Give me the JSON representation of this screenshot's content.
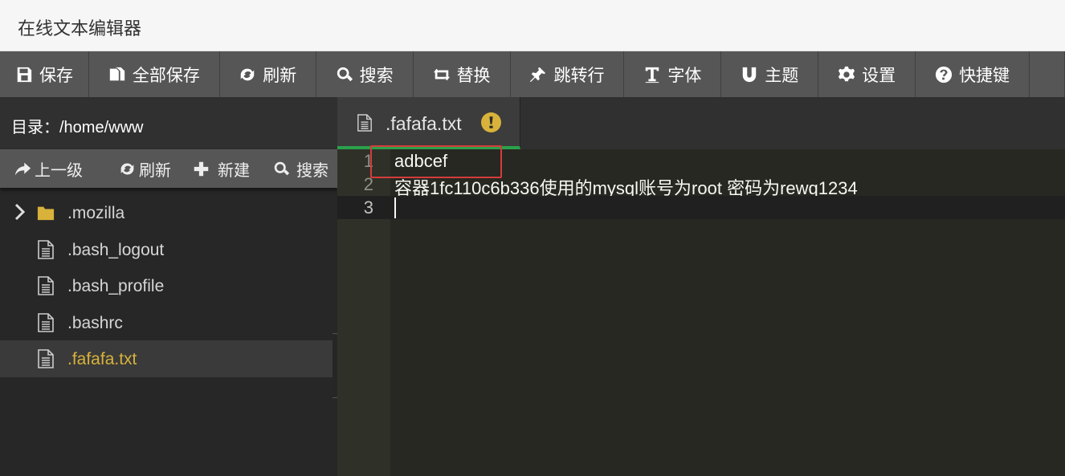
{
  "app": {
    "title": "在线文本编辑器"
  },
  "toolbar": {
    "items": [
      {
        "label": "保存",
        "icon": "save-icon"
      },
      {
        "label": "全部保存",
        "icon": "copy-icon"
      },
      {
        "label": "刷新",
        "icon": "refresh-icon"
      },
      {
        "label": "搜索",
        "icon": "search-icon"
      },
      {
        "label": "替换",
        "icon": "retweet-icon"
      },
      {
        "label": "跳转行",
        "icon": "pin-icon"
      },
      {
        "label": "字体",
        "icon": "text-icon"
      },
      {
        "label": "主题",
        "icon": "magnet-icon"
      },
      {
        "label": "设置",
        "icon": "gear-icon"
      },
      {
        "label": "快捷键",
        "icon": "question-icon"
      }
    ]
  },
  "sidebar": {
    "path_label": "目录：/home/www",
    "actions": {
      "up": "上一级",
      "refresh": "刷新",
      "new": "新建",
      "search": "搜索"
    },
    "files": [
      {
        "name": ".mozilla",
        "type": "folder"
      },
      {
        "name": ".bash_logout",
        "type": "file"
      },
      {
        "name": ".bash_profile",
        "type": "file"
      },
      {
        "name": ".bashrc",
        "type": "file"
      },
      {
        "name": ".fafafa.txt",
        "type": "file",
        "active": true
      }
    ]
  },
  "editor": {
    "tab": {
      "name": ".fafafa.txt",
      "status_icon": "warning-icon"
    },
    "lines": [
      {
        "num": "1",
        "text": "adbcef"
      },
      {
        "num": "2",
        "text": "容器1fc110c6b336使用的mysql账号为root 密码为rewq1234"
      },
      {
        "num": "3",
        "text": ""
      }
    ]
  },
  "colors": {
    "toolbar_bg": "#565656",
    "editor_bg": "#272822",
    "active_file": "#d8b23a",
    "tab_indicator": "#2aa14b",
    "warning": "#d8b23a"
  }
}
